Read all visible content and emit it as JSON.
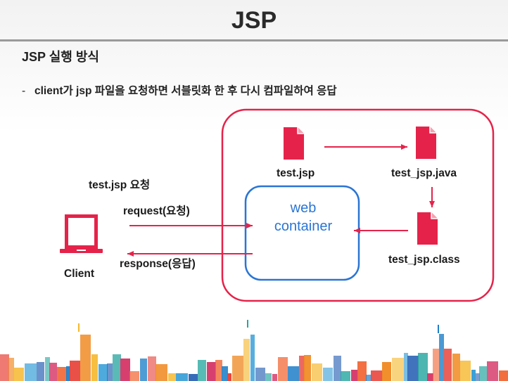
{
  "slide": {
    "title": "JSP",
    "subtitle": "JSP 실행 방식",
    "bullet_dash": "-",
    "bullet_text": "client가 jsp 파일을 요청하면 서블릿화 한 후 다시 컴파일하여 응답"
  },
  "diagram": {
    "client_label": "Client",
    "request_title": "test.jsp 요청",
    "request_label": "request(요청)",
    "response_label": "response(응답)",
    "container_line1": "web",
    "container_line2": "container",
    "file_jsp": "test.jsp",
    "file_java": "test_jsp.java",
    "file_class": "test_jsp.class"
  },
  "colors": {
    "accent_red": "#e5234a",
    "container_blue": "#2a75d4",
    "text_dark": "#1a1a1a"
  },
  "icons": [
    "laptop-icon",
    "file-icon",
    "file-icon",
    "file-icon"
  ]
}
